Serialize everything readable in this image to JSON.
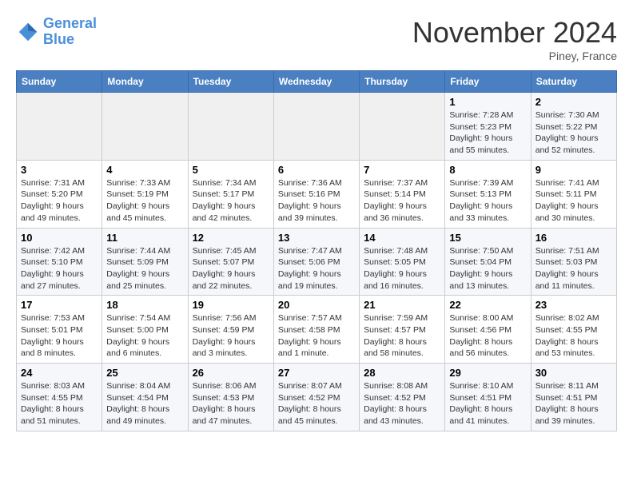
{
  "header": {
    "logo_line1": "General",
    "logo_line2": "Blue",
    "month": "November 2024",
    "location": "Piney, France"
  },
  "weekdays": [
    "Sunday",
    "Monday",
    "Tuesday",
    "Wednesday",
    "Thursday",
    "Friday",
    "Saturday"
  ],
  "weeks": [
    [
      {
        "day": "",
        "info": ""
      },
      {
        "day": "",
        "info": ""
      },
      {
        "day": "",
        "info": ""
      },
      {
        "day": "",
        "info": ""
      },
      {
        "day": "",
        "info": ""
      },
      {
        "day": "1",
        "info": "Sunrise: 7:28 AM\nSunset: 5:23 PM\nDaylight: 9 hours and 55 minutes."
      },
      {
        "day": "2",
        "info": "Sunrise: 7:30 AM\nSunset: 5:22 PM\nDaylight: 9 hours and 52 minutes."
      }
    ],
    [
      {
        "day": "3",
        "info": "Sunrise: 7:31 AM\nSunset: 5:20 PM\nDaylight: 9 hours and 49 minutes."
      },
      {
        "day": "4",
        "info": "Sunrise: 7:33 AM\nSunset: 5:19 PM\nDaylight: 9 hours and 45 minutes."
      },
      {
        "day": "5",
        "info": "Sunrise: 7:34 AM\nSunset: 5:17 PM\nDaylight: 9 hours and 42 minutes."
      },
      {
        "day": "6",
        "info": "Sunrise: 7:36 AM\nSunset: 5:16 PM\nDaylight: 9 hours and 39 minutes."
      },
      {
        "day": "7",
        "info": "Sunrise: 7:37 AM\nSunset: 5:14 PM\nDaylight: 9 hours and 36 minutes."
      },
      {
        "day": "8",
        "info": "Sunrise: 7:39 AM\nSunset: 5:13 PM\nDaylight: 9 hours and 33 minutes."
      },
      {
        "day": "9",
        "info": "Sunrise: 7:41 AM\nSunset: 5:11 PM\nDaylight: 9 hours and 30 minutes."
      }
    ],
    [
      {
        "day": "10",
        "info": "Sunrise: 7:42 AM\nSunset: 5:10 PM\nDaylight: 9 hours and 27 minutes."
      },
      {
        "day": "11",
        "info": "Sunrise: 7:44 AM\nSunset: 5:09 PM\nDaylight: 9 hours and 25 minutes."
      },
      {
        "day": "12",
        "info": "Sunrise: 7:45 AM\nSunset: 5:07 PM\nDaylight: 9 hours and 22 minutes."
      },
      {
        "day": "13",
        "info": "Sunrise: 7:47 AM\nSunset: 5:06 PM\nDaylight: 9 hours and 19 minutes."
      },
      {
        "day": "14",
        "info": "Sunrise: 7:48 AM\nSunset: 5:05 PM\nDaylight: 9 hours and 16 minutes."
      },
      {
        "day": "15",
        "info": "Sunrise: 7:50 AM\nSunset: 5:04 PM\nDaylight: 9 hours and 13 minutes."
      },
      {
        "day": "16",
        "info": "Sunrise: 7:51 AM\nSunset: 5:03 PM\nDaylight: 9 hours and 11 minutes."
      }
    ],
    [
      {
        "day": "17",
        "info": "Sunrise: 7:53 AM\nSunset: 5:01 PM\nDaylight: 9 hours and 8 minutes."
      },
      {
        "day": "18",
        "info": "Sunrise: 7:54 AM\nSunset: 5:00 PM\nDaylight: 9 hours and 6 minutes."
      },
      {
        "day": "19",
        "info": "Sunrise: 7:56 AM\nSunset: 4:59 PM\nDaylight: 9 hours and 3 minutes."
      },
      {
        "day": "20",
        "info": "Sunrise: 7:57 AM\nSunset: 4:58 PM\nDaylight: 9 hours and 1 minute."
      },
      {
        "day": "21",
        "info": "Sunrise: 7:59 AM\nSunset: 4:57 PM\nDaylight: 8 hours and 58 minutes."
      },
      {
        "day": "22",
        "info": "Sunrise: 8:00 AM\nSunset: 4:56 PM\nDaylight: 8 hours and 56 minutes."
      },
      {
        "day": "23",
        "info": "Sunrise: 8:02 AM\nSunset: 4:55 PM\nDaylight: 8 hours and 53 minutes."
      }
    ],
    [
      {
        "day": "24",
        "info": "Sunrise: 8:03 AM\nSunset: 4:55 PM\nDaylight: 8 hours and 51 minutes."
      },
      {
        "day": "25",
        "info": "Sunrise: 8:04 AM\nSunset: 4:54 PM\nDaylight: 8 hours and 49 minutes."
      },
      {
        "day": "26",
        "info": "Sunrise: 8:06 AM\nSunset: 4:53 PM\nDaylight: 8 hours and 47 minutes."
      },
      {
        "day": "27",
        "info": "Sunrise: 8:07 AM\nSunset: 4:52 PM\nDaylight: 8 hours and 45 minutes."
      },
      {
        "day": "28",
        "info": "Sunrise: 8:08 AM\nSunset: 4:52 PM\nDaylight: 8 hours and 43 minutes."
      },
      {
        "day": "29",
        "info": "Sunrise: 8:10 AM\nSunset: 4:51 PM\nDaylight: 8 hours and 41 minutes."
      },
      {
        "day": "30",
        "info": "Sunrise: 8:11 AM\nSunset: 4:51 PM\nDaylight: 8 hours and 39 minutes."
      }
    ]
  ]
}
